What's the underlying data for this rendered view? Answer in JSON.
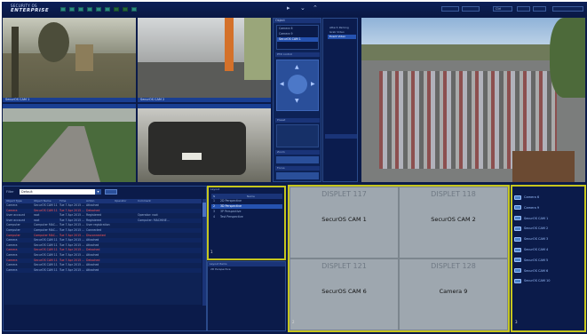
{
  "app": {
    "brand_top": "SECURITY OS",
    "brand_main": "ENTERPRISE"
  },
  "toolbar": {
    "nav_down": "↓",
    "nav_check": "✓",
    "nav_up": "↑",
    "right_box_label": "Ctrl"
  },
  "cameras": {
    "c1": "SecurOS CAM 1",
    "c2": "SecurOS CAM 2",
    "c3": "",
    "c4": ""
  },
  "ptz": {
    "header": "Object",
    "items": [
      "Camera 6",
      "Camera 9",
      "SecurOS CAM 1"
    ],
    "ptz_label": "PTZ control",
    "preset_label": "Preset",
    "zoom_label": "Zoom",
    "focus_label": "Focus"
  },
  "popup_menu": [
    "Attach Parking",
    "Grab Video",
    "Event Video"
  ],
  "bottom_left": {
    "filter_label": "Filter",
    "filter_value": "Default",
    "columns": [
      "Object Type",
      "Object Name",
      "Time",
      "Action",
      "Operator",
      "Comment"
    ],
    "rows": [
      {
        "type": "Camera",
        "name": "SecurOS CAM 11",
        "time": "Tue 7 Apr 2015 ...",
        "action": "Attached",
        "op": "",
        "comment": "",
        "hl": false
      },
      {
        "type": "Camera",
        "name": "SecurOS CAM 11",
        "time": "Tue 7 Apr 2015 ...",
        "action": "Detached",
        "op": "",
        "comment": "",
        "hl": true
      },
      {
        "type": "User account",
        "name": "root",
        "time": "Tue 7 Apr 2015 ...",
        "action": "Registered",
        "op": "",
        "comment": "Operator: root",
        "hl": false
      },
      {
        "type": "User account",
        "name": "root",
        "time": "Tue 7 Apr 2015 ...",
        "action": "Registered",
        "op": "",
        "comment": "Computer: MACHINE...",
        "hl": false
      },
      {
        "type": "Computer",
        "name": "Computer MAC...",
        "time": "Tue 7 Apr 2015 ...",
        "action": "User registration",
        "op": "",
        "comment": "",
        "hl": false
      },
      {
        "type": "Computer",
        "name": "Computer MAC...",
        "time": "Tue 7 Apr 2015 ...",
        "action": "Connected",
        "op": "",
        "comment": "",
        "hl": false
      },
      {
        "type": "Computer",
        "name": "Computer MAC...",
        "time": "Tue 7 Apr 2015 ...",
        "action": "Disconnected",
        "op": "",
        "comment": "",
        "hl": true
      },
      {
        "type": "Camera",
        "name": "SecurOS CAM 11",
        "time": "Tue 7 Apr 2015 ...",
        "action": "Attached",
        "op": "",
        "comment": "",
        "hl": false
      },
      {
        "type": "Camera",
        "name": "SecurOS CAM 11",
        "time": "Tue 7 Apr 2015 ...",
        "action": "Attached",
        "op": "",
        "comment": "",
        "hl": false
      },
      {
        "type": "Camera",
        "name": "SecurOS CAM 11",
        "time": "Tue 7 Apr 2015 ...",
        "action": "Detached",
        "op": "",
        "comment": "",
        "hl": true
      },
      {
        "type": "Camera",
        "name": "SecurOS CAM 11",
        "time": "Tue 7 Apr 2015 ...",
        "action": "Attached",
        "op": "",
        "comment": "",
        "hl": false
      },
      {
        "type": "Camera",
        "name": "SecurOS CAM 11",
        "time": "Tue 7 Apr 2015 ...",
        "action": "Detached",
        "op": "",
        "comment": "",
        "hl": true
      },
      {
        "type": "Camera",
        "name": "SecurOS CAM 11",
        "time": "Tue 7 Apr 2015 ...",
        "action": "Attached",
        "op": "",
        "comment": "",
        "hl": false
      },
      {
        "type": "Camera",
        "name": "SecurOS CAM 11",
        "time": "Tue 7 Apr 2015 ...",
        "action": "Attached",
        "op": "",
        "comment": "",
        "hl": false
      }
    ]
  },
  "layouts": {
    "header": "Layout",
    "col_num": "N",
    "col_name": "Name",
    "items": [
      {
        "n": "1",
        "name": "2D Perspective",
        "sel": false
      },
      {
        "n": "2",
        "name": "3D Perspective",
        "sel": true
      },
      {
        "n": "3",
        "name": "3P Perspective",
        "sel": false
      },
      {
        "n": "4",
        "name": "Test Perspective",
        "sel": false
      }
    ],
    "panel_num": "1"
  },
  "layout_items": {
    "header": "Layout Items",
    "item": "2D Perspective"
  },
  "displets": [
    {
      "title": "DISPLET 117",
      "cam": "SecurOS CAM 1"
    },
    {
      "title": "DISPLET 118",
      "cam": "SecurOS CAM 2"
    },
    {
      "title": "DISPLET 121",
      "cam": "SecurOS CAM 6"
    },
    {
      "title": "DISPLET 128",
      "cam": "Camera 9"
    }
  ],
  "displet_panel_num": "2",
  "objects": {
    "items": [
      "Camera 6",
      "Camera 9",
      "SecurOS CAM 1",
      "SecurOS CAM 2",
      "SecurOS CAM 3",
      "SecurOS CAM 4",
      "SecurOS CAM 5",
      "SecurOS CAM 6",
      "SecurOS CAM 10"
    ],
    "panel_num": "3"
  }
}
